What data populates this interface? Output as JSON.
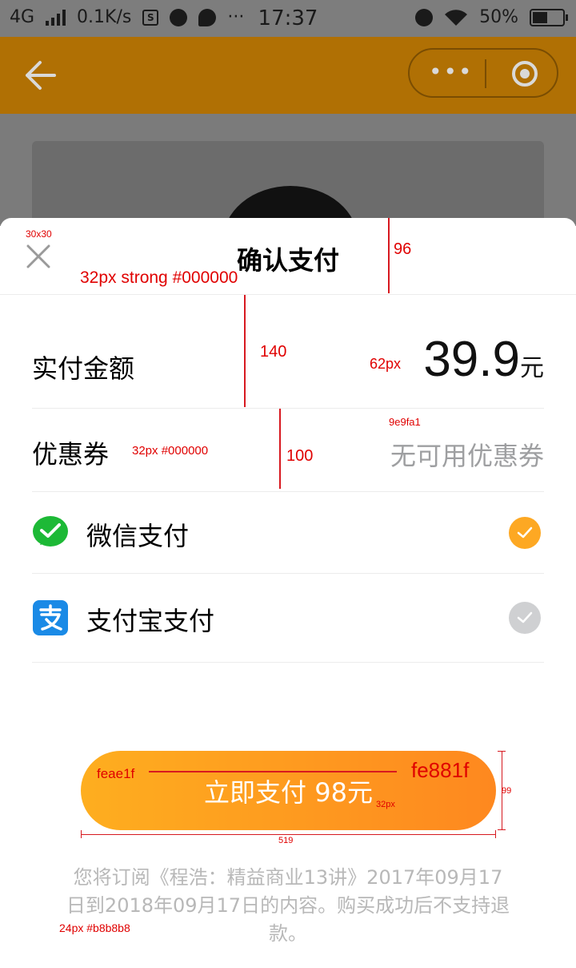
{
  "status_bar": {
    "network": "4G",
    "speed": "0.1K/s",
    "time": "17:37",
    "battery": "50%"
  },
  "navbar": {
    "capsule_more": "•••"
  },
  "sheet": {
    "title": "确认支付",
    "amount_label": "实付金额",
    "amount_value": "39.9",
    "amount_unit": "元",
    "coupon_label": "优惠券",
    "coupon_value": "无可用优惠券",
    "payment_methods": [
      {
        "label": "微信支付",
        "selected": true
      },
      {
        "label": "支付宝支付",
        "selected": false
      }
    ],
    "pay_button": "立即支付 98元",
    "notice": "您将订阅《程浩：精益商业13讲》2017年09月17日到2018年09月17日的内容。购买成功后不支持退款。"
  },
  "annotations": {
    "close_size": "30x30",
    "title_spec": "32px strong  #000000",
    "header_height": "96",
    "amount_row_height": "140",
    "amount_font": "62px",
    "coupon_color": "9e9fa1",
    "label_spec": "32px #000000",
    "coupon_row_height": "100",
    "gradient_start": "feae1f",
    "gradient_end": "fe881f",
    "button_font": "32px",
    "button_height": "99",
    "button_width": "519",
    "notice_spec": "24px  #b8b8b8"
  },
  "colors": {
    "check_selected": "#fda823",
    "check_unselected": "#cfd0d2",
    "wechat_green": "#1db936",
    "alipay_blue": "#1a8ae6"
  }
}
